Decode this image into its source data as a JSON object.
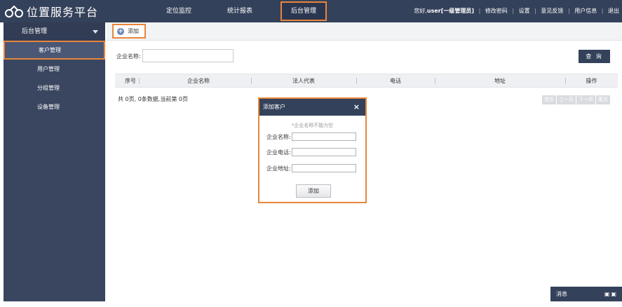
{
  "app": {
    "title": "位置服务平台"
  },
  "nav": {
    "items": [
      {
        "label": "定位监控"
      },
      {
        "label": "统计报表"
      },
      {
        "label": "后台管理"
      }
    ]
  },
  "top_links": {
    "greeting": "您好,",
    "user": "user[一级管理员]",
    "change_password": "修改密码",
    "settings": "设置",
    "feedback": "意见反馈",
    "account_info": "用户信息",
    "logout": "退出"
  },
  "sidebar": {
    "header": "后台管理",
    "items": [
      {
        "label": "客户管理"
      },
      {
        "label": "用户管理"
      },
      {
        "label": "分组管理"
      },
      {
        "label": "设备管理"
      }
    ]
  },
  "toolbar": {
    "add_label": "添加"
  },
  "search": {
    "label": "企业名称:",
    "value": "",
    "button": "查 询"
  },
  "table": {
    "columns": [
      "序号",
      "企业名称",
      "法人代表",
      "电话",
      "地址",
      "操作"
    ]
  },
  "pager": {
    "info": "共 0页, 0条数据,当前第 0页",
    "first": "首页",
    "prev": "上一页",
    "next": "下一页",
    "last": "尾页"
  },
  "dialog": {
    "title": "添加客户",
    "hint": "*企业名称不能为空",
    "fields": [
      {
        "label": "企业名称:",
        "value": ""
      },
      {
        "label": "企业电话:",
        "value": ""
      },
      {
        "label": "企业地址:",
        "value": ""
      }
    ],
    "submit": "添加"
  },
  "message_panel": {
    "label": "消息"
  },
  "colors": {
    "header": "#34415a",
    "sidebar": "#3a4660",
    "highlight": "#e8853b"
  }
}
